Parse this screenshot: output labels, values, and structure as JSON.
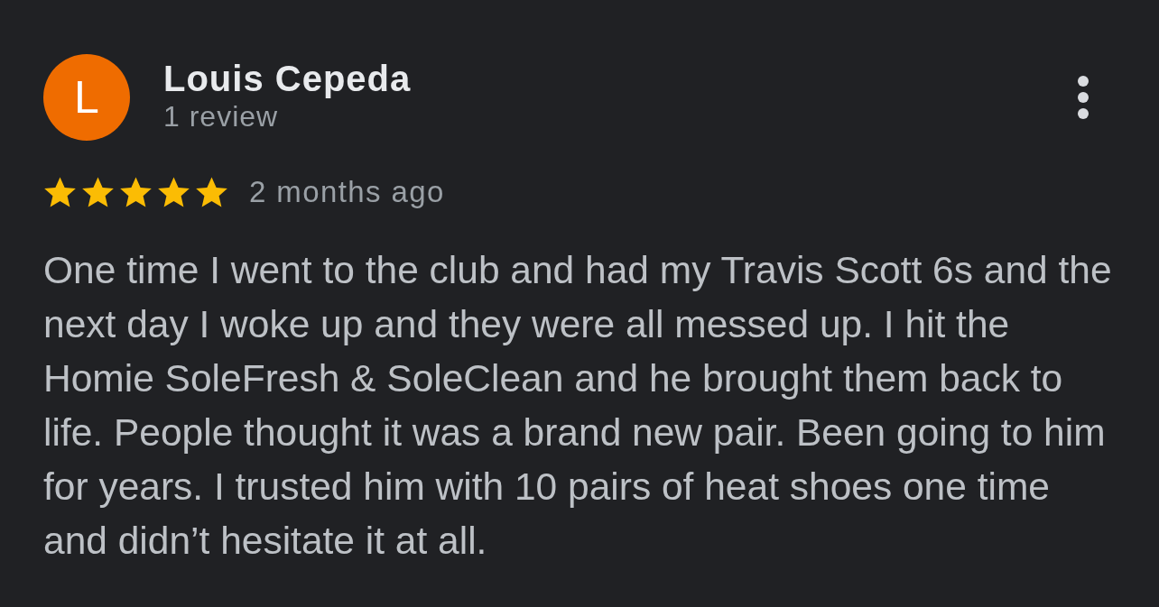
{
  "review": {
    "author": {
      "initial": "L",
      "name": "Louis Cepeda",
      "review_count": "1 review"
    },
    "stars": 5,
    "time": "2 months ago",
    "text": "One time I went to the club and had my Travis Scott 6s and the next day I woke up and they were all messed up. I hit the Homie SoleFresh & SoleClean and he brought them back to life. People thought it was a brand new pair. Been going to him for years. I trusted him with 10 pairs of heat shoes one time and didn’t hesitate it at all."
  }
}
